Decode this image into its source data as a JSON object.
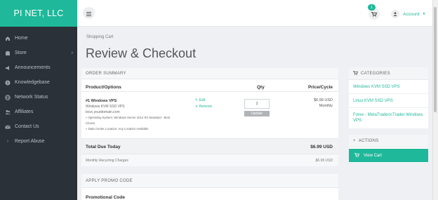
{
  "brand": "PI NET, LLC",
  "sidebar": {
    "items": [
      {
        "label": "Home",
        "icon": "home-icon"
      },
      {
        "label": "Store",
        "icon": "store-icon",
        "has_submenu": true
      },
      {
        "label": "Announcements",
        "icon": "megaphone-icon"
      },
      {
        "label": "Knowledgebase",
        "icon": "info-icon"
      },
      {
        "label": "Network Status",
        "icon": "globe-icon"
      },
      {
        "label": "Affiliates",
        "icon": "users-icon"
      },
      {
        "label": "Contact Us",
        "icon": "envelope-icon"
      },
      {
        "label": "Report Abuse",
        "icon": "chevron-right-icon"
      }
    ]
  },
  "topbar": {
    "cart_count": "1",
    "account_label": "Account"
  },
  "breadcrumb": "Shopping Cart",
  "page_title": "Review & Checkout",
  "order_summary": {
    "heading": "ORDER SUMMARY",
    "columns": {
      "product": "Product/Options",
      "qty": "Qty",
      "price": "Price/Cycle"
    },
    "item": {
      "name": "#1 Windows VPS",
      "group": "Windows KVM SSD VPS",
      "domain": "bcvc.yourdomain.com",
      "options": [
        "» Operating System: Windows Server 2012 R2 Standard - Best",
        "Choice",
        "» Data Center Location: Any Location Available"
      ],
      "edit_label": "Edit",
      "remove_label": "Remove",
      "qty": "1",
      "update_label": "Update",
      "price": "$6.99 USD",
      "cycle": "Monthly"
    },
    "total_label": "Total Due Today",
    "total_value": "$6.99 USD",
    "recurring_label": "Monthly Recurring Charges",
    "recurring_value": "$6.99 USD"
  },
  "promo": {
    "heading": "APPLY PROMO CODE",
    "label": "Promotional Code"
  },
  "categories": {
    "heading": "CATEGORIES",
    "items": [
      "Windows KVM SSD VPS",
      "Linux KVM SSD VPS",
      "Forex - MetaTrader/cTrader Windows VPS"
    ]
  },
  "actions": {
    "heading": "ACTIONS",
    "view_cart": "View Cart"
  },
  "colors": {
    "accent": "#1fb89a",
    "sidebar": "#2a3139"
  }
}
